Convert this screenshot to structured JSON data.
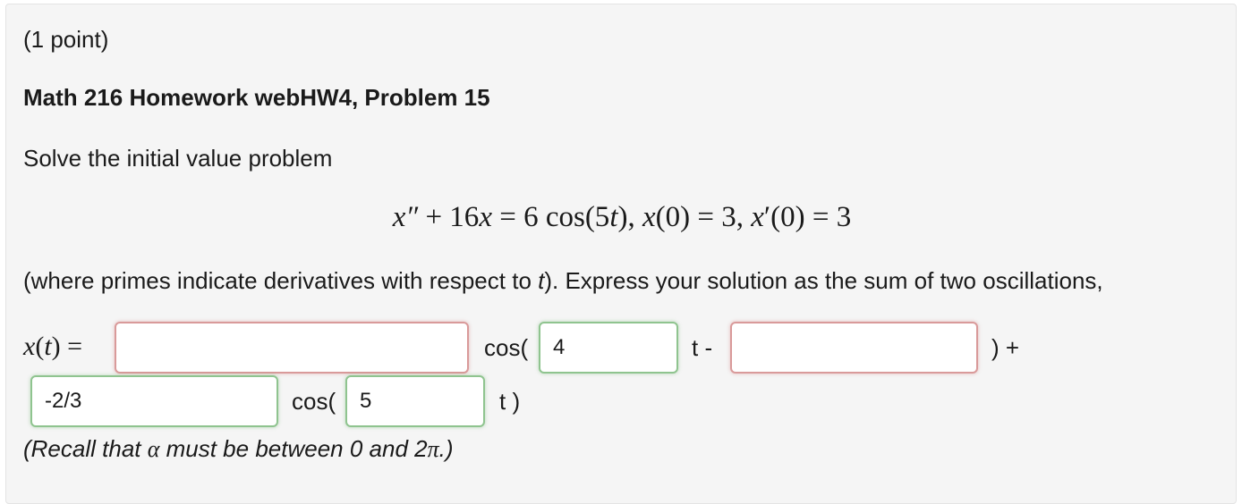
{
  "problem": {
    "points": "(1 point)",
    "title": "Math 216 Homework webHW4, Problem 15",
    "intro": "Solve the initial value problem",
    "equation": {
      "lhs_var": "x″",
      "plus": " + 16",
      "x1": "x",
      "eq_rhs": " = 6 cos(5",
      "t1": "t",
      "part2": "), ",
      "x2": "x",
      "part3": "(0) = 3, ",
      "x3": "x",
      "part4": "′(0) = 3"
    },
    "instructions_pre": "(where primes indicate derivatives with respect to ",
    "instructions_var": "t",
    "instructions_post": "). Express your solution as the sum of two oscillations,",
    "solution_lhs_x": "x",
    "solution_lhs_open": "(",
    "solution_lhs_t": "t",
    "solution_lhs_close": ") =",
    "recall_pre": "(Recall that ",
    "recall_alpha": "α",
    "recall_mid": " must be between 0 and 2",
    "recall_pi": "π",
    "recall_post": ".)"
  },
  "answers": {
    "amplitude1": {
      "value": "",
      "status": "incorrect"
    },
    "frequency1": {
      "value": "4",
      "status": "correct"
    },
    "phase": {
      "value": "",
      "status": "incorrect"
    },
    "amplitude2": {
      "value": "-2/3",
      "status": "correct"
    },
    "frequency2": {
      "value": "5",
      "status": "correct"
    }
  },
  "labels": {
    "cos_open_1": "cos(",
    "t_minus": "t -",
    "close_plus": ") +",
    "cos_open_2": "cos(",
    "t_close": "t )"
  },
  "colors": {
    "incorrect_border": "#d99a9a",
    "correct_border": "#8fc48f",
    "panel_background": "#f5f5f5"
  }
}
